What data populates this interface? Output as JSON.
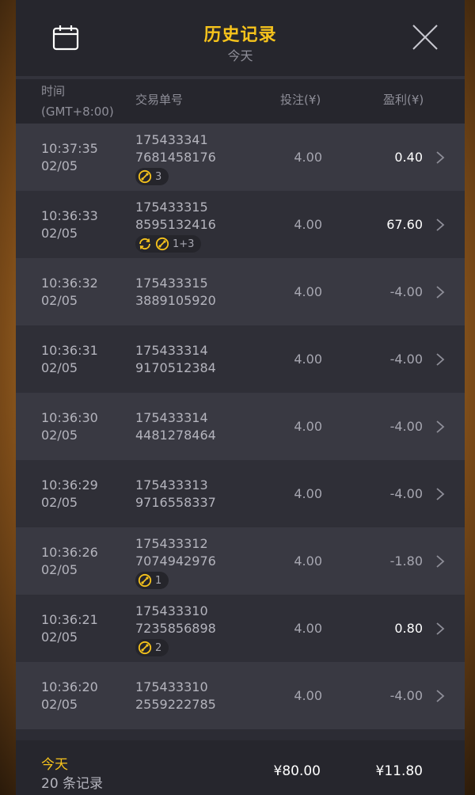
{
  "header": {
    "title": "历史记录",
    "subtitle": "今天",
    "icons": [
      "calendar-icon",
      "close-icon"
    ]
  },
  "columns": {
    "time_line1": "时间",
    "time_line2": "(GMT+8:00)",
    "order": "交易单号",
    "bet": "投注(¥)",
    "profit": "盈利(¥)"
  },
  "rows": [
    {
      "time": "10:37:35",
      "date": "02/05",
      "order1": "175433341",
      "order2": "7681458176",
      "bet": "4.00",
      "profit": "0.40",
      "positive": true,
      "badge": {
        "icons": [
          "free-spin-icon"
        ],
        "text": "3"
      }
    },
    {
      "time": "10:36:33",
      "date": "02/05",
      "order1": "175433315",
      "order2": "8595132416",
      "bet": "4.00",
      "profit": "67.60",
      "positive": true,
      "badge": {
        "icons": [
          "respin-icon",
          "free-spin-icon"
        ],
        "text": "1+3"
      }
    },
    {
      "time": "10:36:32",
      "date": "02/05",
      "order1": "175433315",
      "order2": "3889105920",
      "bet": "4.00",
      "profit": "-4.00",
      "positive": false
    },
    {
      "time": "10:36:31",
      "date": "02/05",
      "order1": "175433314",
      "order2": "9170512384",
      "bet": "4.00",
      "profit": "-4.00",
      "positive": false
    },
    {
      "time": "10:36:30",
      "date": "02/05",
      "order1": "175433314",
      "order2": "4481278464",
      "bet": "4.00",
      "profit": "-4.00",
      "positive": false
    },
    {
      "time": "10:36:29",
      "date": "02/05",
      "order1": "175433313",
      "order2": "9716558337",
      "bet": "4.00",
      "profit": "-4.00",
      "positive": false
    },
    {
      "time": "10:36:26",
      "date": "02/05",
      "order1": "175433312",
      "order2": "7074942976",
      "bet": "4.00",
      "profit": "-1.80",
      "positive": false,
      "badge": {
        "icons": [
          "free-spin-icon"
        ],
        "text": "1"
      }
    },
    {
      "time": "10:36:21",
      "date": "02/05",
      "order1": "175433310",
      "order2": "7235856898",
      "bet": "4.00",
      "profit": "0.80",
      "positive": true,
      "badge": {
        "icons": [
          "free-spin-icon"
        ],
        "text": "2"
      }
    },
    {
      "time": "10:36:20",
      "date": "02/05",
      "order1": "175433310",
      "order2": "2559222785",
      "bet": "4.00",
      "profit": "-4.00",
      "positive": false
    }
  ],
  "footer": {
    "label": "今天",
    "count": "20 条记录",
    "total_bet": "¥80.00",
    "total_profit": "¥11.80"
  },
  "colors": {
    "accent": "#f6c31c",
    "panel_bg": "#2c2c34",
    "row_odd": "#393942",
    "row_even": "#2f2f37",
    "text_muted": "#b4b4bd"
  }
}
